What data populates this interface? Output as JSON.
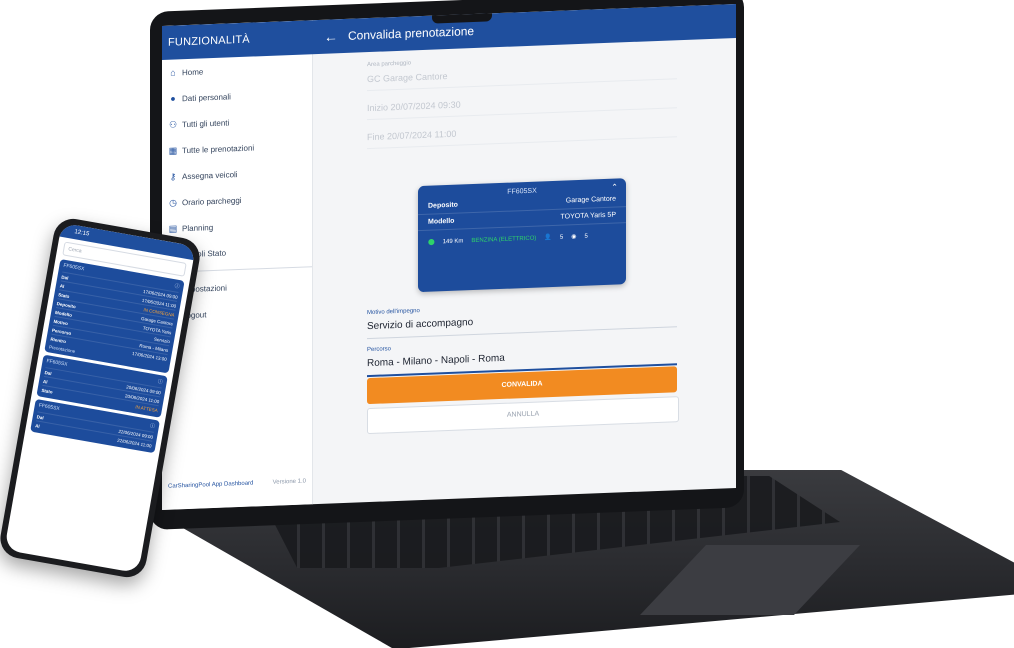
{
  "laptop": {
    "sidebar": {
      "header": "FUNZIONALITÀ",
      "items": [
        {
          "icon": "home-icon",
          "glyph": "⌂",
          "label": "Home"
        },
        {
          "icon": "person-icon",
          "glyph": "●",
          "label": "Dati personali"
        },
        {
          "icon": "users-icon",
          "glyph": "⚇",
          "label": "Tutti gli utenti"
        },
        {
          "icon": "calendar-icon",
          "glyph": "▦",
          "label": "Tutte le prenotazioni"
        },
        {
          "icon": "key-icon",
          "glyph": "⚷",
          "label": "Assegna veicoli"
        },
        {
          "icon": "clock-icon",
          "glyph": "◷",
          "label": "Orario parcheggi"
        },
        {
          "icon": "planning-icon",
          "glyph": "▤",
          "label": "Planning"
        },
        {
          "icon": "car-icon",
          "glyph": "▭",
          "label": "Veicoli Stato"
        },
        {
          "icon": "settings-icon",
          "glyph": "⚙",
          "label": "Impostazioni"
        },
        {
          "icon": "logout-icon",
          "glyph": "⎋",
          "label": "Logout"
        }
      ],
      "footer_left": "CarSharingPool App Dashboard",
      "footer_right": "Versione 1.0"
    },
    "topbar": {
      "back_icon": "←",
      "title": "Convalida prenotazione"
    },
    "form": {
      "parking_label": "Area parcheggio",
      "parking_value": "GC Garage Cantore",
      "start_value": "Inizio 20/07/2024 09:30",
      "end_value": "Fine 20/07/2024 11:00"
    },
    "card": {
      "plate": "FF605SX",
      "deposit_label": "Deposito",
      "deposit_value": "Garage Cantore",
      "model_label": "Modello",
      "model_value": "TOYOTA Yaris 5P",
      "range": "149 Km",
      "fuel": "BENZINA (ELETTRICO)",
      "seats": "5",
      "doors": "5"
    },
    "form2": {
      "purpose_label": "Motivo dell'impegno",
      "purpose_value": "Servizio di accompagno",
      "route_label": "Percorso",
      "route_value": "Roma - Milano - Napoli - Roma"
    },
    "buttons": {
      "confirm": "CONVALIDA",
      "cancel": "ANNULLA"
    }
  },
  "phone": {
    "status": "12:15",
    "search_placeholder": "Cerca",
    "cards": [
      {
        "head": "FF605SX",
        "rows": [
          {
            "k": "Dal",
            "v": "17/06/2024 09:00"
          },
          {
            "k": "Al",
            "v": "17/06/2024 11:00"
          },
          {
            "k": "Stato",
            "v": "IN CONSEGNA",
            "orange": true
          },
          {
            "k": "Deposito",
            "v": "Garage Cantore"
          },
          {
            "k": "Modello",
            "v": "TOYOTA Yaris"
          },
          {
            "k": "Motivo",
            "v": "Servizio"
          },
          {
            "k": "Percorso",
            "v": "Roma - Milano"
          },
          {
            "k": "Rientro",
            "v": "17/06/2024 13:00"
          }
        ],
        "foot": "Prenotazione"
      },
      {
        "head": "FF605SX",
        "rows": [
          {
            "k": "Dal",
            "v": "20/06/2024 09:00"
          },
          {
            "k": "Al",
            "v": "20/06/2024 11:00"
          },
          {
            "k": "Stato",
            "v": "IN ATTESA",
            "orange": true
          }
        ],
        "foot": ""
      },
      {
        "head": "FF605SX",
        "rows": [
          {
            "k": "Dal",
            "v": "22/06/2024 09:00"
          },
          {
            "k": "Al",
            "v": "22/06/2024 11:00"
          }
        ],
        "foot": ""
      }
    ]
  }
}
